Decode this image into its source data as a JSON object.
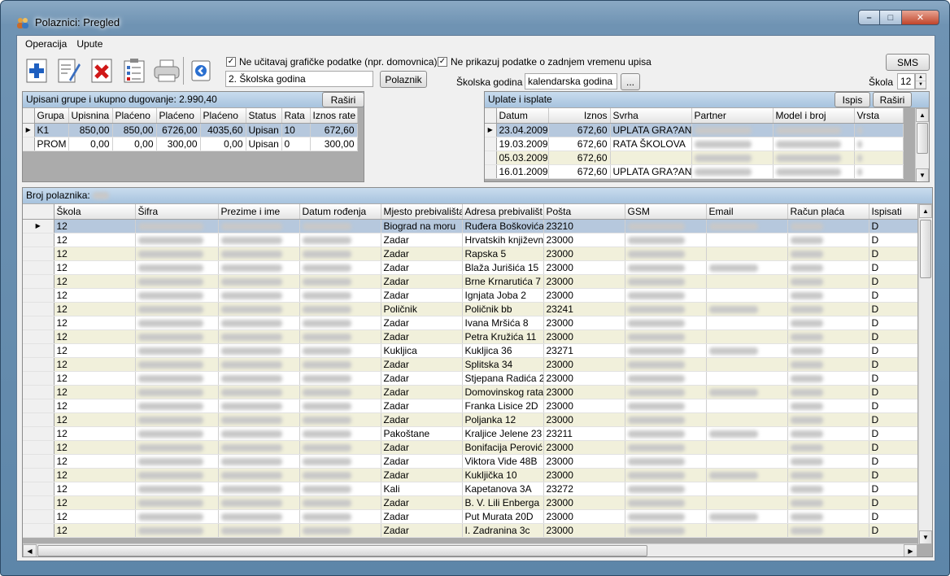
{
  "window": {
    "title": "Polaznici: Pregled",
    "min_label": "–",
    "max_label": "□",
    "close_label": "✕"
  },
  "menu": {
    "items": [
      "Operacija",
      "Upute"
    ]
  },
  "toolbar": {
    "icons": [
      "new-icon",
      "edit-icon",
      "delete-icon",
      "checklist-icon",
      "print-icon",
      "back-icon"
    ],
    "chk1_label": "Ne učitavaj grafičke podatke (npr. domovnica)",
    "chk1_checked": "✓",
    "chk2_label": "Ne prikazuj podatke o zadnjem vremenu upisa",
    "chk2_checked": "✓",
    "grade_value": "2. Školska godina",
    "polaznik_button": "Polaznik",
    "sms_button": "SMS",
    "skolska_godina_label": "Školska godina",
    "skolska_godina_value": "kalendarska godina",
    "browse_button": "...",
    "skola_label": "Škola",
    "skola_value": "12"
  },
  "groups": {
    "caption": "Upisani grupe i ukupno dugovanje: 2.990,40",
    "expand_button": "Raširi",
    "columns": [
      "Grupa",
      "Upisnina",
      "Plaćeno",
      "Plaćeno",
      "Plaćeno",
      "Status",
      "Rata",
      "Iznos rate"
    ],
    "rows": [
      [
        "K1",
        "850,00",
        "850,00",
        "6726,00",
        "4035,60",
        "Upisan",
        "10",
        "672,60"
      ],
      [
        "PROM",
        "0,00",
        "0,00",
        "300,00",
        "0,00",
        "Upisan",
        "0",
        "300,00"
      ]
    ]
  },
  "payments": {
    "caption": "Uplate i isplate",
    "ispis_button": "Ispis",
    "expand_button": "Raširi",
    "columns": [
      "Datum",
      "Iznos",
      "Svrha",
      "Partner",
      "Model i broj",
      "Vrsta"
    ],
    "rows": [
      [
        "23.04.2009",
        "672,60",
        "UPLATA GRA?AN"
      ],
      [
        "19.03.2009",
        "672,60",
        "RATA ŠKOLOVA"
      ],
      [
        "05.03.2009",
        "672,60",
        ""
      ],
      [
        "16.01.2009",
        "672,60",
        "UPLATA GRA?AN"
      ]
    ]
  },
  "students": {
    "caption": "Broj polaznika:",
    "columns": [
      "Škola",
      "Šifra",
      "Prezime i ime",
      "Datum rođenja",
      "Mjesto prebivališta",
      "Adresa prebivališt",
      "Pošta",
      "GSM",
      "Email",
      "Račun plaća",
      "Ispisati"
    ],
    "rows": [
      [
        "12",
        "Biograd na moru",
        "Ruđera Boškovića",
        "23210",
        "D"
      ],
      [
        "12",
        "Zadar",
        "Hrvatskih književni",
        "23000",
        "D"
      ],
      [
        "12",
        "Zadar",
        "Rapska 5",
        "23000",
        "D"
      ],
      [
        "12",
        "Zadar",
        "Blaža Jurišića 15",
        "23000",
        "D"
      ],
      [
        "12",
        "Zadar",
        "Brne Krnarutića 7",
        "23000",
        "D"
      ],
      [
        "12",
        "Zadar",
        "Ignjata Joba 2",
        "23000",
        "D"
      ],
      [
        "12",
        "Poličnik",
        "Poličnik bb",
        "23241",
        "D"
      ],
      [
        "12",
        "Zadar",
        "Ivana Mršića 8",
        "23000",
        "D"
      ],
      [
        "12",
        "Zadar",
        "Petra Kružića 11",
        "23000",
        "D"
      ],
      [
        "12",
        "Kukljica",
        "Kukljica 36",
        "23271",
        "D"
      ],
      [
        "12",
        "Zadar",
        "Splitska 34",
        "23000",
        "D"
      ],
      [
        "12",
        "Zadar",
        "Stjepana Radića 2",
        "23000",
        "D"
      ],
      [
        "12",
        "Zadar",
        "Domovinskog rata",
        "23000",
        "D"
      ],
      [
        "12",
        "Zadar",
        "Franka Lisice 2D",
        "23000",
        "D"
      ],
      [
        "12",
        "Zadar",
        "Poljanka 12",
        "23000",
        "D"
      ],
      [
        "12",
        "Pakoštane",
        "Kraljice Jelene 23",
        "23211",
        "D"
      ],
      [
        "12",
        "Zadar",
        "Bonifacija Perović",
        "23000",
        "D"
      ],
      [
        "12",
        "Zadar",
        "Viktora Vide 48B",
        "23000",
        "D"
      ],
      [
        "12",
        "Zadar",
        "Kukljička 10",
        "23000",
        "D"
      ],
      [
        "12",
        "Kali",
        "Kapetanova 3A",
        "23272",
        "D"
      ],
      [
        "12",
        "Zadar",
        "B. V. Lili Enberga",
        "23000",
        "D"
      ],
      [
        "12",
        "Zadar",
        "Put Murata 20D",
        "23000",
        "D"
      ],
      [
        "12",
        "Zadar",
        "I. Zadranina 3c",
        "23000",
        "D"
      ]
    ]
  }
}
